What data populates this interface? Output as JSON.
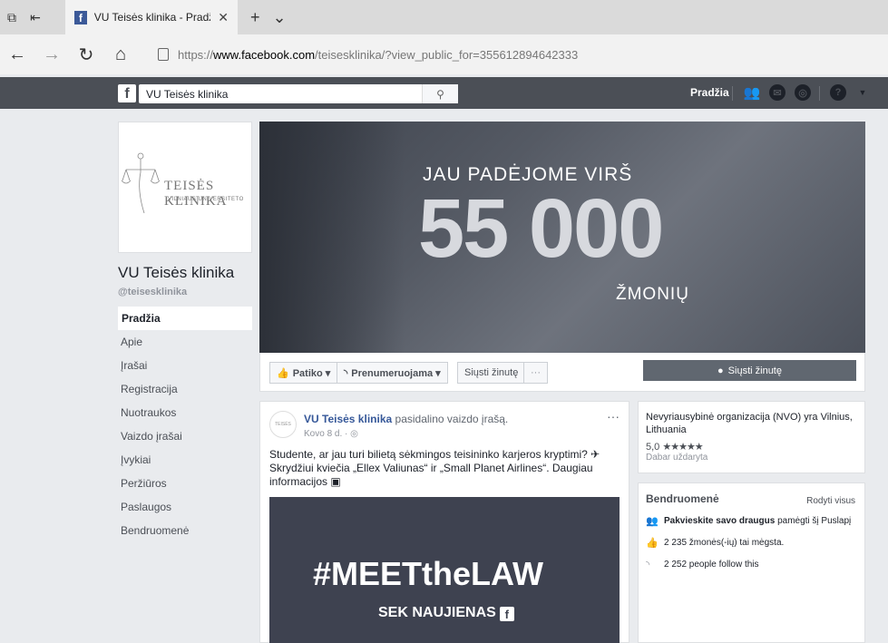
{
  "browser": {
    "tab_title": "VU Teisės klinika - Pradž",
    "url_prefix": "https://",
    "url_host": "www.facebook.com",
    "url_path": "/teisesklinika/?view_public_for=355612894642333"
  },
  "fb_bar": {
    "search_value": "VU Teisės klinika",
    "home_label": "Pradžia"
  },
  "page": {
    "name": "VU Teisės klinika",
    "handle": "@teisesklinika",
    "logo_text": "TEISĖS KLINIKA",
    "logo_sub": "VILNIAUS UNIVERSITETO"
  },
  "nav": [
    "Pradžia",
    "Apie",
    "Įrašai",
    "Registracija",
    "Nuotraukos",
    "Vaizdo įrašai",
    "Įvykiai",
    "Peržiūros",
    "Paslaugos",
    "Bendruomenė"
  ],
  "cover": {
    "line1": "JAU PADĖJOME VIRŠ",
    "number": "55 000",
    "line2": "ŽMONIŲ"
  },
  "actions": {
    "like": "Patiko ▾",
    "follow": "Prenumeruojama ▾",
    "message": "Siųsti žinutę",
    "more": "···",
    "send_main": "Siųsti žinutę"
  },
  "post": {
    "author": "VU Teisės klinika",
    "action": "pasidalino vaizdo įrašą.",
    "date": "Kovo 8 d. · ◎",
    "text": "Studente, ar jau turi bilietą sėkmingos teisininko karjeros kryptimi? ✈ Skrydžiui kviečia „Ellex Valiunas“ ir „Small Planet Airlines“. Daugiau informacijos ▣",
    "video_hashtag": "#MEETtheLAW",
    "video_sub": "SEK NAUJIENAS"
  },
  "info": {
    "category": "Nevyriausybinė organizacija (NVO) yra Vilnius, Lithuania",
    "rating": "5,0",
    "stars": "★★★★★",
    "status": "Dabar uždaryta"
  },
  "community": {
    "title": "Bendruomenė",
    "see_all": "Rodyti visus",
    "invite_bold": "Pakvieskite savo draugus",
    "invite_rest": "pamėgti šį Puslapį",
    "likes": "2 235 žmonės(-ių) tai mėgsta.",
    "follows": "2 252 people follow this"
  }
}
